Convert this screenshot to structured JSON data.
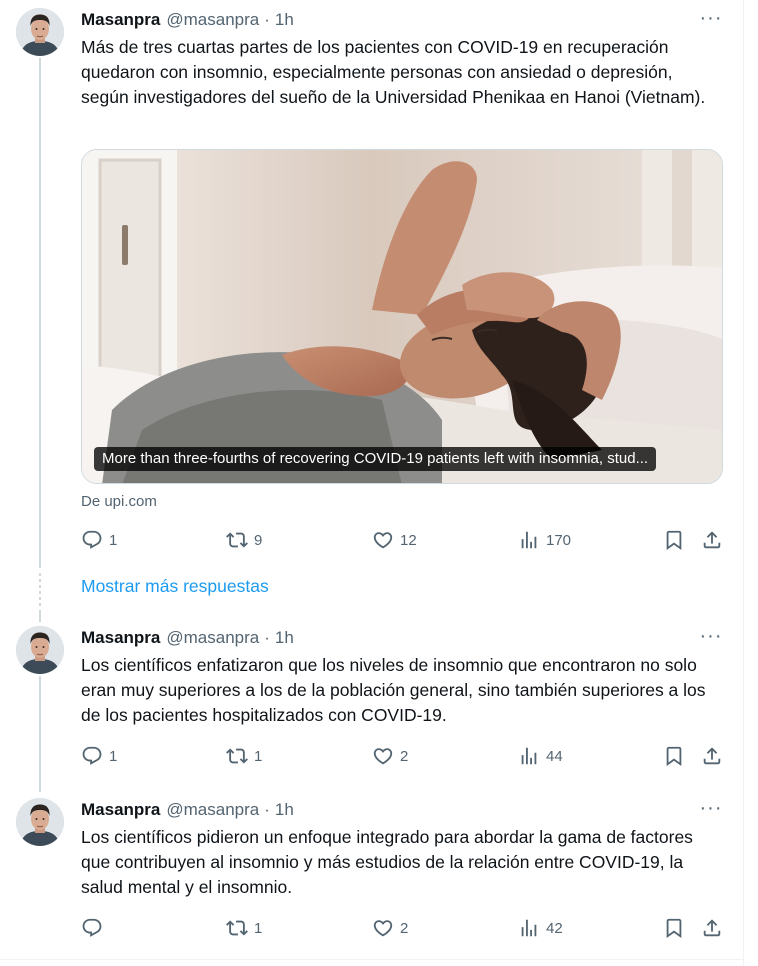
{
  "colors": {
    "accent": "#1d9bf0",
    "muted": "#536471",
    "text": "#0f1419"
  },
  "tweets": [
    {
      "name": "Masanpra",
      "handle": "@masanpra",
      "separator": "·",
      "time": "1h",
      "text": "Más de tres cuartas partes de los pacientes con COVID-19 en recuperación quedaron con insomnio, especialmente personas con ansiedad o depresión, según investigadores del sueño de la Universidad Phenikaa en Hanoi (Vietnam).",
      "card": {
        "caption": "More than three-fourths of recovering COVID-19 patients left with insomnia, stud...",
        "source": "De upi.com"
      },
      "stats": {
        "replies": "1",
        "retweets": "9",
        "likes": "12",
        "views": "170"
      }
    },
    {
      "name": "Masanpra",
      "handle": "@masanpra",
      "separator": "·",
      "time": "1h",
      "text": "Los científicos enfatizaron que los niveles de insomnio que encontraron no solo eran muy superiores a los de la población general, sino también superiores a los de los pacientes hospitalizados con COVID-19.",
      "stats": {
        "replies": "1",
        "retweets": "1",
        "likes": "2",
        "views": "44"
      }
    },
    {
      "name": "Masanpra",
      "handle": "@masanpra",
      "separator": "·",
      "time": "1h",
      "text": "Los científicos pidieron un enfoque integrado para abordar la gama de factores que contribuyen al insomnio y más estudios de la relación entre COVID-19, la salud mental y el insomnio.",
      "stats": {
        "replies": "",
        "retweets": "1",
        "likes": "2",
        "views": "42"
      }
    }
  ],
  "show_more_label": "Mostrar más respuestas",
  "more_icon": "···",
  "icons": [
    "reply-icon",
    "retweet-icon",
    "like-icon",
    "views-icon",
    "bookmark-icon",
    "share-icon",
    "more-icon"
  ]
}
